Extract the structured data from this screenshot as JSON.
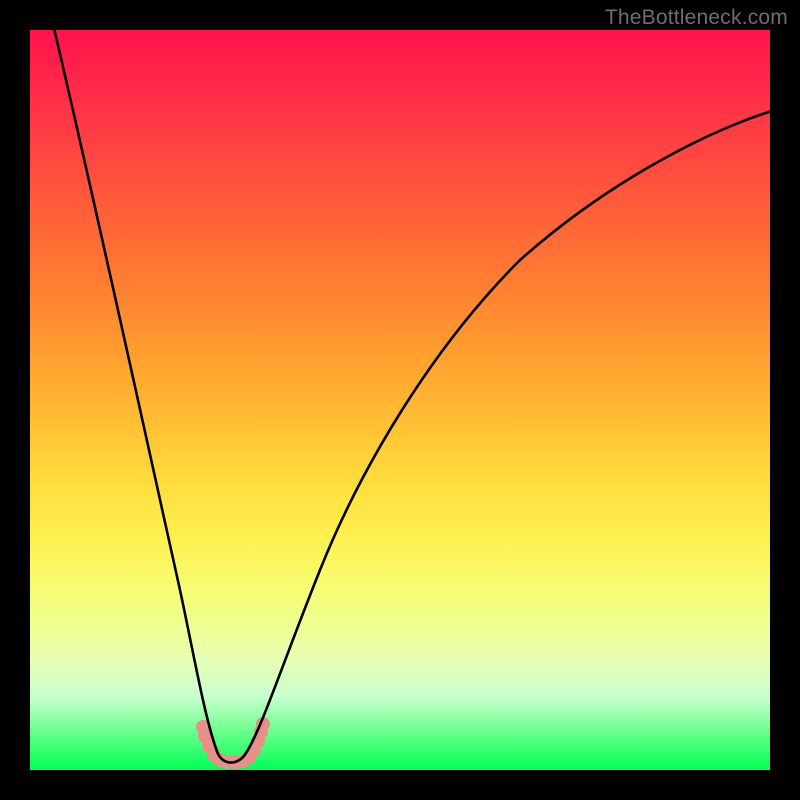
{
  "watermark": "TheBottleneck.com",
  "chart_data": {
    "type": "line",
    "title": "",
    "xlabel": "",
    "ylabel": "",
    "xlim": [
      0,
      100
    ],
    "ylim": [
      0,
      100
    ],
    "grid": false,
    "legend": false,
    "background": "rainbow-vertical",
    "series": [
      {
        "name": "bottleneck-curve",
        "x": [
          0,
          2,
          5,
          8,
          11,
          14,
          17,
          20,
          22,
          23.5,
          24.5,
          25.5,
          26,
          27,
          28,
          29,
          30,
          32,
          35,
          40,
          46,
          54,
          62,
          72,
          82,
          92,
          100
        ],
        "y": [
          100,
          92,
          80,
          68,
          56,
          44,
          32,
          18,
          8,
          3,
          0.5,
          0,
          0,
          0,
          0.5,
          2,
          5,
          11,
          21,
          34,
          47,
          58,
          66,
          74,
          80,
          85,
          88
        ]
      }
    ],
    "annotations": [
      {
        "name": "trough-blobs",
        "approx_x_range": [
          22.5,
          30
        ],
        "approx_y_range": [
          0,
          6
        ],
        "color": "#e88f89"
      }
    ]
  }
}
